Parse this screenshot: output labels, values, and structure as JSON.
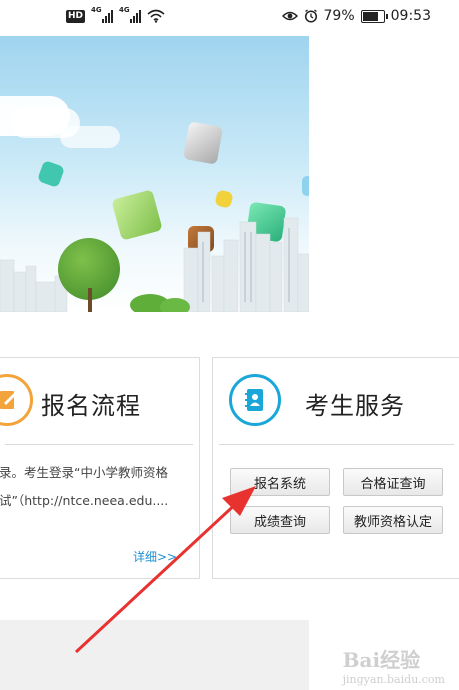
{
  "status_bar": {
    "hd": "HD",
    "net1": "4G",
    "net2": "4G",
    "battery_pct": "79%",
    "time": "09:53",
    "battery_level": 0.79
  },
  "registration_card": {
    "title": "报名流程",
    "text_line1": "录。考生登录“中小学教师资格",
    "text_line2": "试”（http://ntce.neea.edu....",
    "detail_link": "详细>>"
  },
  "service_card": {
    "title": "考生服务",
    "buttons": [
      "报名系统",
      "合格证查询",
      "成绩查询",
      "教师资格认定"
    ]
  },
  "watermark": {
    "brand": "Bai经验",
    "url": "jingyan.baidu.com"
  },
  "colors": {
    "accent_orange": "#f2a33a",
    "accent_cyan": "#1aa6d8",
    "link_blue": "#1f8fd0",
    "arrow_red": "#e8322f"
  }
}
